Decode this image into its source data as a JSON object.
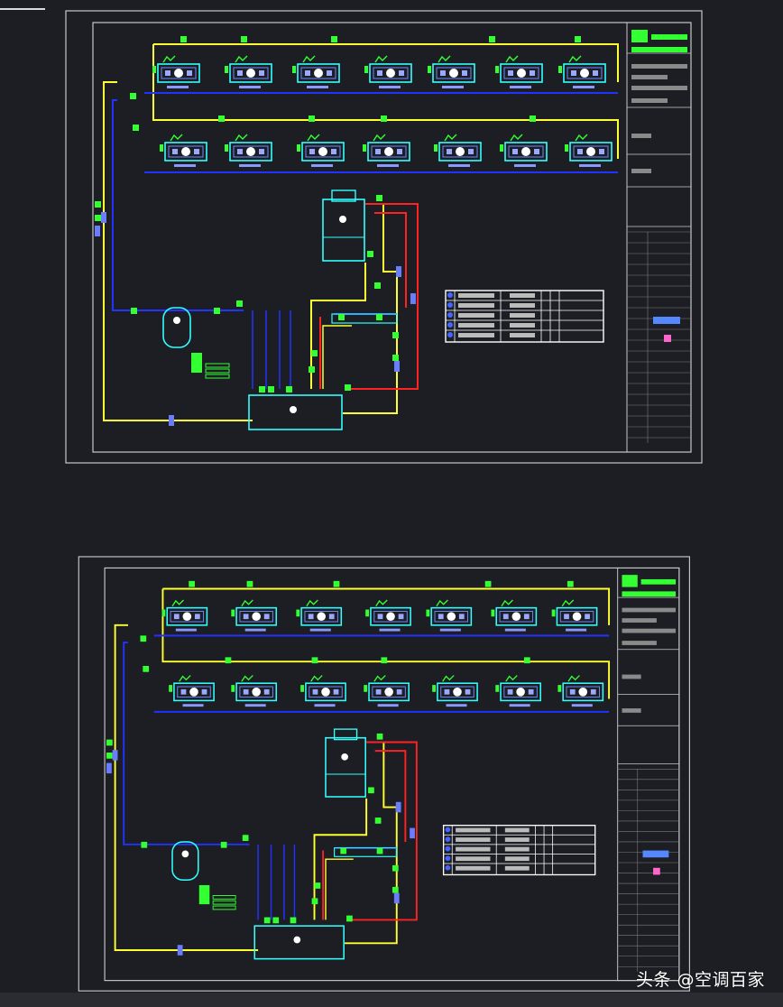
{
  "watermark": "头条 @空调百家",
  "colors": {
    "background": "#1c1e24",
    "frame": "#c8c8c8",
    "supply_pipe": "#ffff33",
    "return_pipe": "#2233ff",
    "cooling_pipe": "#ff2222",
    "equipment": "#33ffff",
    "valves": "#33ff33"
  },
  "drawings": [
    {
      "name": "upper-drawing-sheet"
    },
    {
      "name": "lower-drawing-sheet"
    }
  ]
}
